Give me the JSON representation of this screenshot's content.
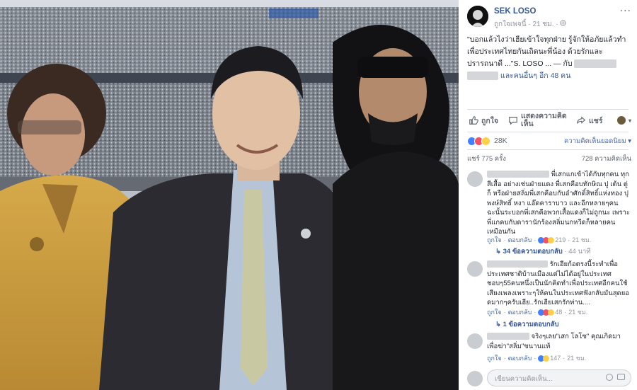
{
  "post": {
    "page_name": "SEK LOSO",
    "meta": "ถูกใจเพจนี้ · 21 ชม. · ",
    "more": "···",
    "caption_line1": "\"บอกแล้วไงว่าเฮียเข้าใจทุกฝ่าย รู้จักให้อภัยแล้วทำเพื่อประเทศไทยกันเถิดนะพี่น้อง ด้วยรักและปรารถนาดี ...\"S. LOSO ... — กับ",
    "caption_line2": "และคนอื่นๆ อีก 48 คน"
  },
  "actions": {
    "like": "ถูกใจ",
    "comment": "แสดงความคิดเห็น",
    "share": "แชร์"
  },
  "reactions": {
    "count": "28K",
    "sort": "ความคิดเห็นยอดนิยม ▾",
    "shares": "แชร์ 775 ครั้ง",
    "comments": "728 ความคิดเห็น",
    "colors": {
      "like": "#4080ff",
      "love": "#f25268",
      "haha": "#fbd14b"
    }
  },
  "comments": [
    {
      "text": "พี่เสกแกเข้าได้กับทุกคน ทุกสีเสื้อ อย่างเช่นฝ่ายแดง พี่เสกคือบทักษิณ ปู เต้น ตู่ ก็ หรือฝ่ายสลิ่มพี่เสกคือบกับอำศักดิ์สิทธิ์แห่งทอง ปุพงษ์สิทธิ์ หงา แอ๊ดคาราบาว และอีกหลายๆคน ฉะนั้นระบอกพี่เสกคือพวกเสื้อแดงก็ไม่ถูกนะ เพราะพี่แกคบกับดารานักร้องสลิ่มนกหวีดก็หลายคนเหมือนกัน",
      "like": "ถูกใจ",
      "reply": "ตอบกลับ",
      "reacts": "219",
      "time": "21 ชม.",
      "replies": "34 ข้อความตอบกลับ",
      "replies_time": "44 นาที"
    },
    {
      "text": "รักเฮียก้อตรงนี้ระทำเพื่อประเทศชาติบ้านเมืองแต่ไม่ได้อยู่ในประเทศ ชอบๆ55คนหนึ่งเป็นนักคิดทำเพื่อประเทศอีกคนใช้เสียงเพลงเพราะๆให้คนในประเทศฟังกลับมันสุดยอดมากๆครับเฮีย..รักเฮียเสกรักท่าน....",
      "like": "ถูกใจ",
      "reply": "ตอบกลับ",
      "reacts": "48",
      "time": "21 ชม.",
      "replies": "1 ข้อความตอบกลับ",
      "replies_time": ""
    },
    {
      "text": "จริงๆเลย\"เสก โลโซ\" คุณเกิดมาเพื่อฆ่า\"สลิ่ม\"ขนานแท้",
      "like": "ถูกใจ",
      "reply": "ตอบกลับ",
      "reacts": "147",
      "time": "21 ชม.",
      "replies": "",
      "replies_time": ""
    }
  ],
  "input": {
    "placeholder": "เขียนความคิดเห็น..."
  }
}
